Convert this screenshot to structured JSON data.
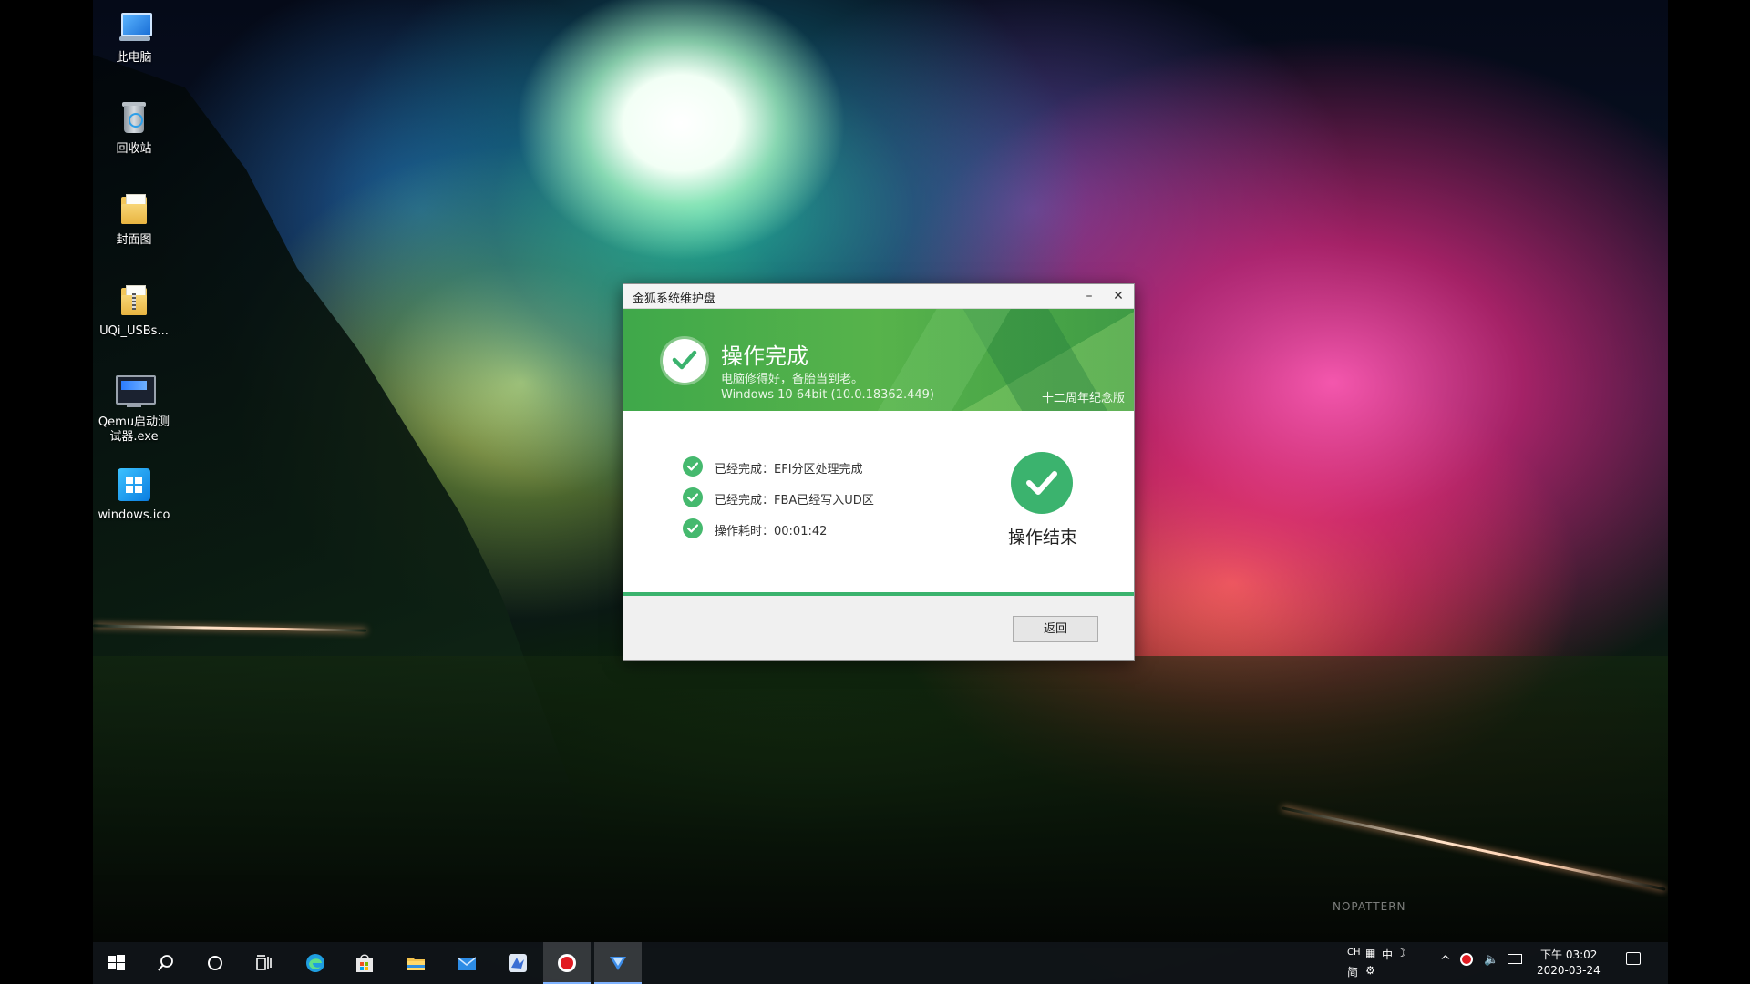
{
  "desktop": {
    "icons": [
      {
        "label": "此电脑"
      },
      {
        "label": "回收站"
      },
      {
        "label": "封面图"
      },
      {
        "label": "UQi_USBs..."
      },
      {
        "label": "Qemu启动测试器.exe"
      },
      {
        "label": "windows.ico"
      }
    ],
    "wallpaper_signature": "NOPATTERN"
  },
  "dialog": {
    "title": "金狐系统维护盘",
    "minimize_label": "–",
    "close_label": "✕",
    "banner": {
      "title": "操作完成",
      "subtitle": "电脑修得好，备胎当到老。",
      "os_info": "Windows 10 64bit (10.0.18362.449)",
      "edition": "十二周年纪念版"
    },
    "steps": [
      {
        "text": "已经完成：EFI分区处理完成"
      },
      {
        "text": "已经完成：FBA已经写入UD区"
      },
      {
        "text": "操作耗时：00:01:42"
      }
    ],
    "status_label": "操作结束",
    "back_button": "返回",
    "colors": {
      "accent": "#3bb36e",
      "banner": "#4caf50"
    }
  },
  "taskbar": {
    "items": [
      "start-icon",
      "search-icon",
      "cortana-icon",
      "task-view-icon",
      "edge-icon",
      "store-icon",
      "file-explorer-icon",
      "mail-icon",
      "app-icon",
      "record-icon",
      "active-app-icon"
    ],
    "tray": {
      "lang_top": "CH",
      "lang_bottom": "简",
      "ime_mode": "中",
      "time": "下午 03:02",
      "date": "2020-03-24"
    }
  }
}
